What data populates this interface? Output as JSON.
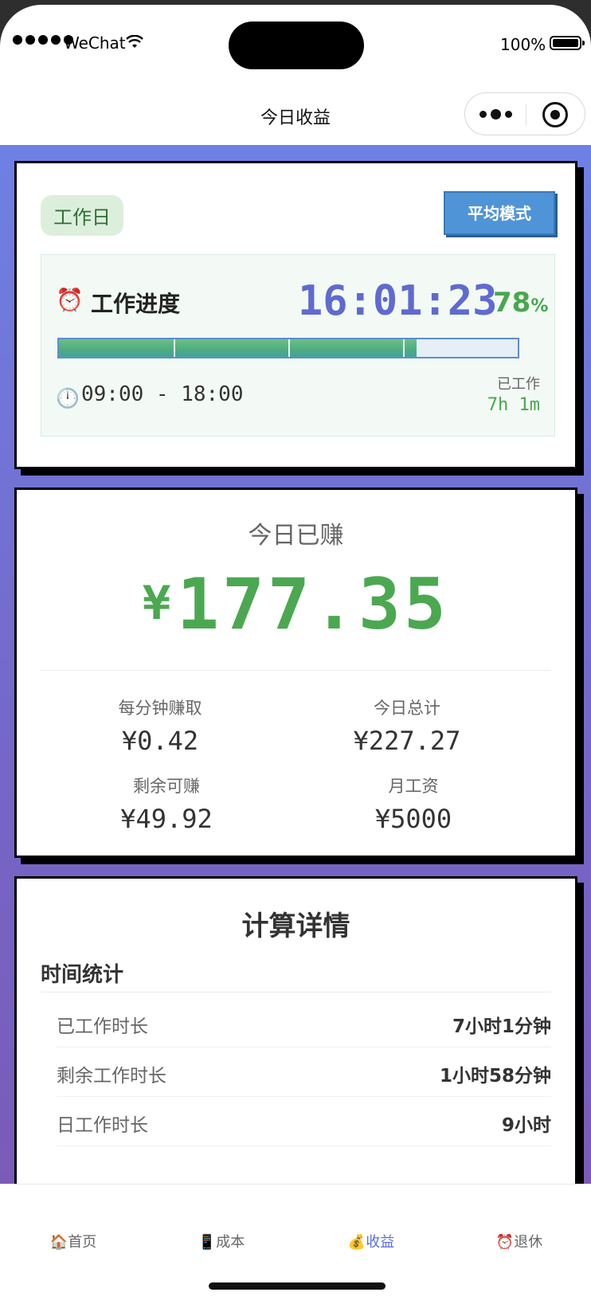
{
  "status_bar": {
    "carrier": "WeChat",
    "battery": "100%"
  },
  "nav": {
    "title": "今日收益"
  },
  "progress_card": {
    "day_tag": "工作日",
    "mode_button": "平均模式",
    "progress_icon": "⏰",
    "progress_label": "工作进度",
    "current_time": "16:01:23",
    "percent_value": "78",
    "percent_sign": "%",
    "progress_fraction": 0.78,
    "clock_icon": "🕛",
    "work_hours": "09:00 - 18:00",
    "worked_label": "已工作",
    "worked_value": "7h 1m"
  },
  "earnings_card": {
    "label": "今日已赚",
    "currency": "¥",
    "amount": "177.35",
    "stats": [
      {
        "label": "每分钟赚取",
        "value": "¥0.42"
      },
      {
        "label": "今日总计",
        "value": "¥227.27"
      },
      {
        "label": "剩余可赚",
        "value": "¥49.92"
      },
      {
        "label": "月工资",
        "value": "¥5000"
      }
    ]
  },
  "details_card": {
    "title": "计算详情",
    "section": "时间统计",
    "rows": [
      {
        "label": "已工作时长",
        "value": "7小时1分钟"
      },
      {
        "label": "剩余工作时长",
        "value": "1小时58分钟"
      },
      {
        "label": "日工作时长",
        "value": "9小时"
      }
    ]
  },
  "tabbar": {
    "tabs": [
      {
        "icon": "🏠",
        "label": "首页"
      },
      {
        "icon": "📱",
        "label": "成本"
      },
      {
        "icon": "💰",
        "label": "收益"
      },
      {
        "icon": "⏰",
        "label": "退休"
      }
    ],
    "active_index": 2
  },
  "colors": {
    "accent": "#5b6ee0",
    "earn_green": "#4ba851",
    "mode_blue": "#4f94d6"
  }
}
